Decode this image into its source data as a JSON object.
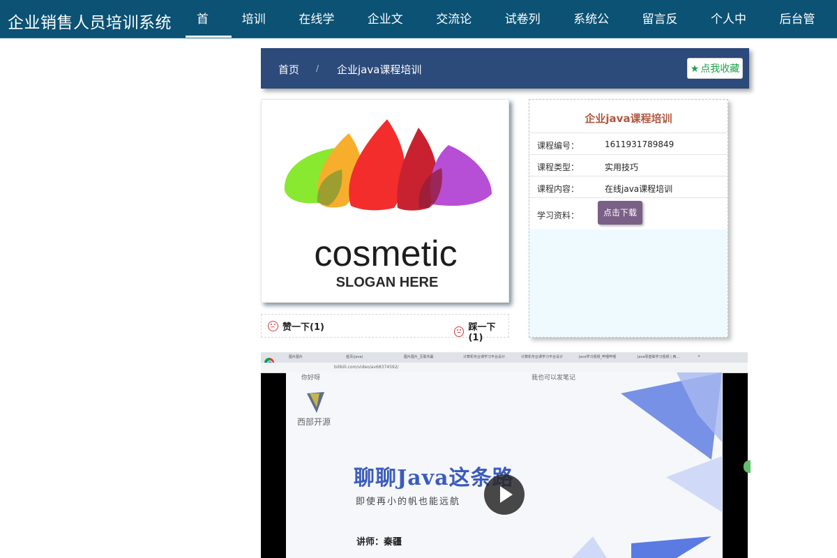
{
  "brand": "企业销售人员培训系统",
  "nav": {
    "items": [
      "首页",
      "培训班",
      "在线学习",
      "企业文化",
      "交流论坛",
      "试卷列表",
      "系统公告",
      "留言反馈",
      "个人中心",
      "后台管理"
    ],
    "active_index": 0
  },
  "breadcrumb": {
    "home": "首页",
    "separator": "/",
    "current": "企业java课程培训",
    "favorite_label": "点我收藏"
  },
  "cover": {
    "logo_text": "cosmetic",
    "slogan": "SLOGAN HERE",
    "petal_colors": [
      "#7ee81f",
      "#f7a81c",
      "#f21b1b",
      "#c41020",
      "#b13fd2"
    ]
  },
  "votes": {
    "like_label": "赞一下(1)",
    "dislike_label": "踩一下(1)"
  },
  "course": {
    "title": "企业java课程培训",
    "fields": [
      {
        "label": "课程编号：",
        "value": "1611931789849"
      },
      {
        "label": "课程类型：",
        "value": "实用技巧"
      },
      {
        "label": "课程内容：",
        "value": "在线java课程培训"
      }
    ],
    "material_label": "学习资料：",
    "download_label": "点击下载"
  },
  "video": {
    "tabs": [
      "图片图片",
      "首页(java)",
      "图片图片_互联共赢",
      "计算机专业课学习平台设计",
      "计算机专业课学习平台设计",
      "Java学习视频_哔哩哔哩",
      "Java零基础学习视频 | 西...",
      "+"
    ],
    "url": "bilibili.com/video/av68374592/",
    "slide_top_left": "你好呀",
    "slide_top_mid": "我也可以发笔记",
    "logo_text": "西部开源",
    "title": "聊聊Java这条路",
    "subtitle": "即使再小的帆也能远航",
    "teacher": "讲师：秦疆"
  },
  "colors": {
    "topbar": "#0b5274",
    "breadcrumb": "#2c4a7a",
    "accent_title": "#b0573f",
    "download_btn": "#7a5f86",
    "favorite_text": "#19a14a"
  }
}
